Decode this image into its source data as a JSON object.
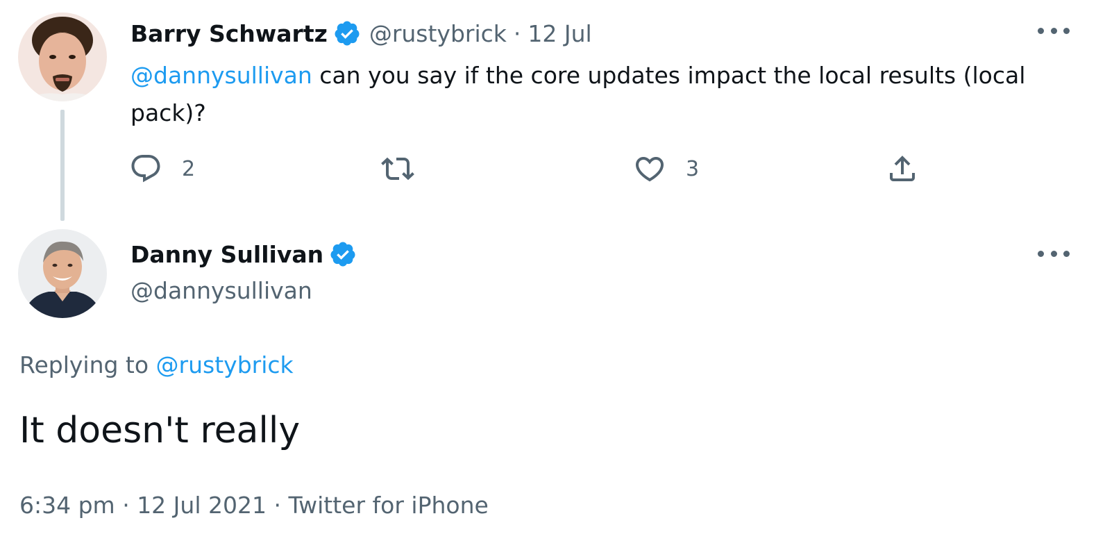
{
  "parent_tweet": {
    "author_name": "Barry Schwartz",
    "handle": "@rustybrick",
    "separator": "·",
    "date": "12 Jul",
    "mention": "@dannysullivan",
    "text": " can you say if the core updates impact the local results (local pack)?",
    "reply_count": "2",
    "like_count": "3"
  },
  "main_tweet": {
    "author_name": "Danny Sullivan",
    "handle": "@dannysullivan",
    "replying_prefix": "Replying to ",
    "replying_handle": "@rustybrick",
    "text": "It doesn't really",
    "time": "6:34 pm",
    "sep1": " · ",
    "date": "12 Jul 2021",
    "sep2": " · ",
    "source": "Twitter for iPhone"
  },
  "icons": {
    "verified": "verified-badge-icon",
    "more": "more-icon",
    "reply": "reply-icon",
    "retweet": "retweet-icon",
    "like": "heart-icon",
    "share": "share-icon"
  },
  "colors": {
    "link": "#1d9bf0",
    "muted": "#536471",
    "text": "#0f1419",
    "verified": "#1d9bf0",
    "thread_line": "#cfd9de"
  }
}
